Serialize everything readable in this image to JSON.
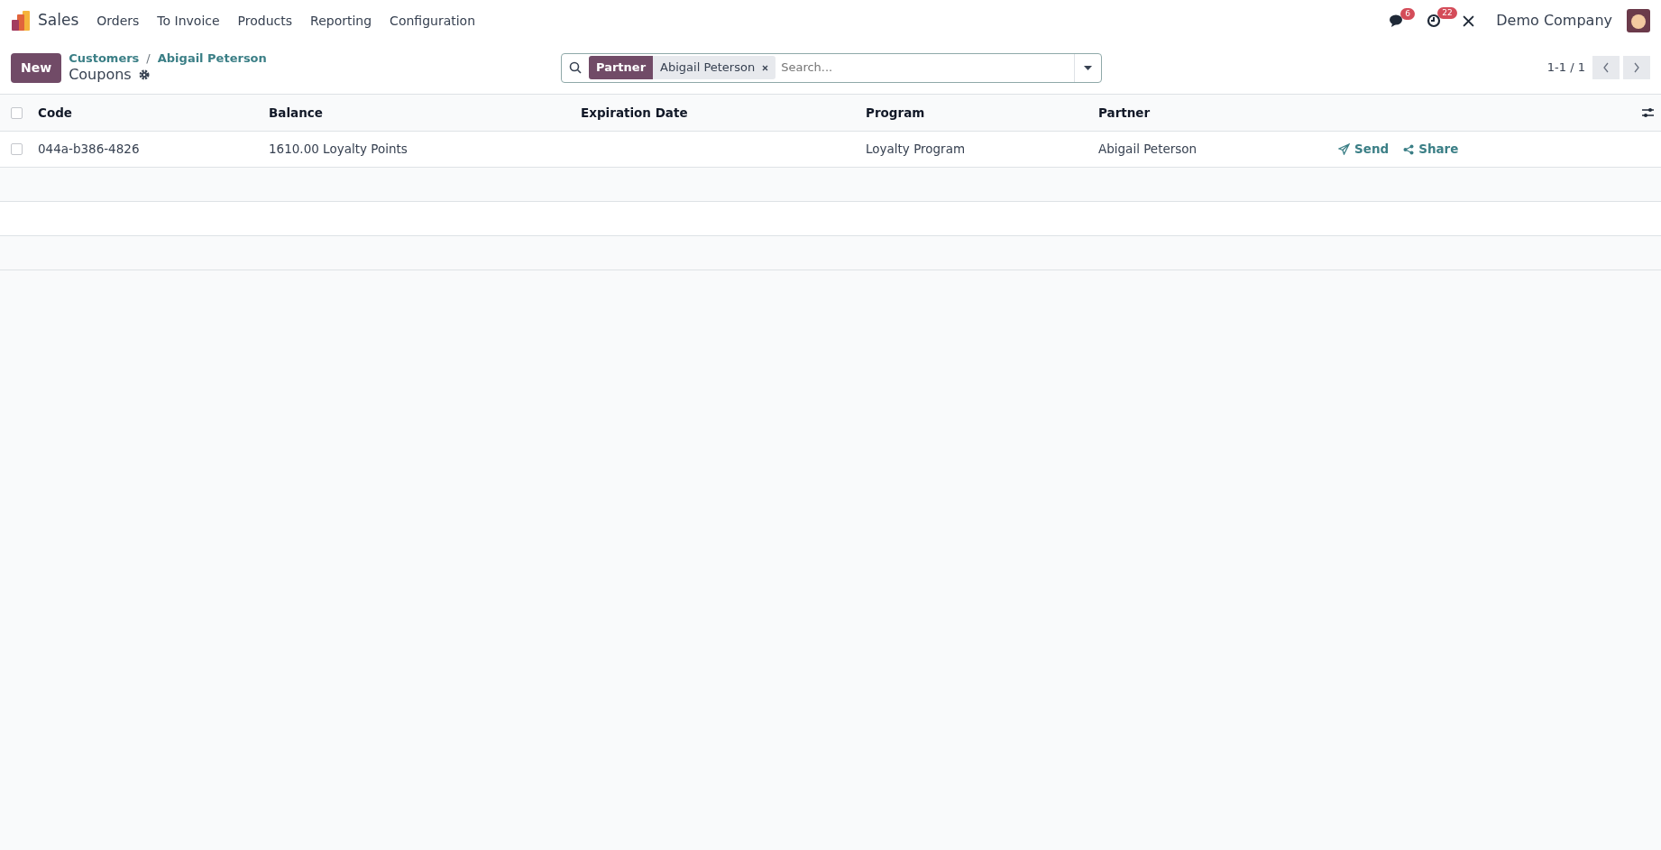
{
  "navbar": {
    "app": "Sales",
    "menu": [
      "Orders",
      "To Invoice",
      "Products",
      "Reporting",
      "Configuration"
    ],
    "messages_badge": "6",
    "activities_badge": "22",
    "company": "Demo Company"
  },
  "control_panel": {
    "new_button": "New",
    "breadcrumbs": [
      "Customers",
      "Abigail Peterson"
    ],
    "breadcrumb_separator": "/",
    "title": "Coupons",
    "search": {
      "facet_label": "Partner",
      "facet_value": "Abigail Peterson",
      "placeholder": "Search..."
    },
    "pager": "1-1 / 1"
  },
  "table": {
    "columns": [
      "Code",
      "Balance",
      "Expiration Date",
      "Program",
      "Partner"
    ],
    "rows": [
      {
        "checked": false,
        "cells": [
          "044a-b386-4826",
          "1610.00 Loyalty Points",
          "",
          "Loyalty Program",
          "Abigail Peterson"
        ],
        "actions": [
          "Send",
          "Share"
        ]
      }
    ],
    "all_checked": false
  }
}
